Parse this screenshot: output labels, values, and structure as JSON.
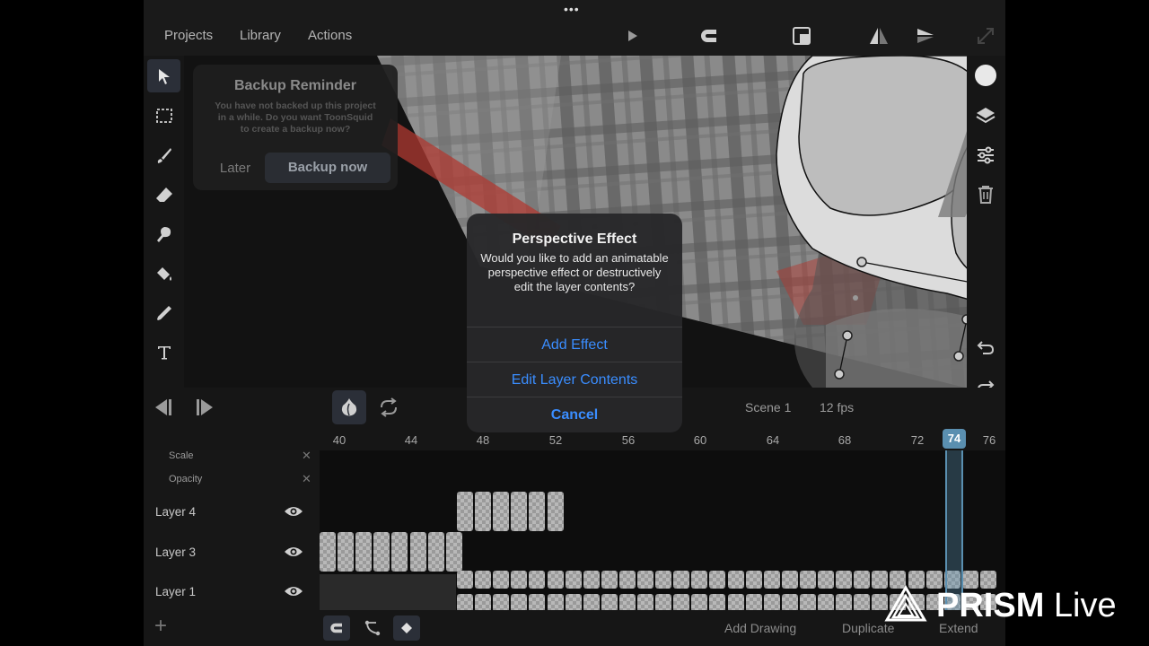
{
  "menu": {
    "projects": "Projects",
    "library": "Library",
    "actions": "Actions"
  },
  "top_dots": "•••",
  "backup_reminder": {
    "title": "Backup Reminder",
    "message": "You have not backed up this project in a while. Do you want ToonSquid to create a backup now?",
    "later": "Later",
    "backup_now": "Backup now"
  },
  "dialog": {
    "title": "Perspective Effect",
    "message": "Would you like to add an animatable perspective effect or destructively edit the layer contents?",
    "add_effect": "Add Effect",
    "edit_layer_contents": "Edit Layer Contents",
    "cancel": "Cancel"
  },
  "playback": {
    "scene": "Scene 1",
    "fps": "12 fps"
  },
  "ruler": {
    "ticks": [
      "40",
      "44",
      "48",
      "52",
      "56",
      "60",
      "64",
      "68",
      "72",
      "76"
    ],
    "current_frame": "74"
  },
  "properties": [
    "Scale",
    "Opacity"
  ],
  "layers": [
    "Layer 4",
    "Layer 3",
    "Layer 1"
  ],
  "bottom": {
    "add": "+",
    "add_drawing": "Add Drawing",
    "duplicate": "Duplicate",
    "extend": "Extend"
  },
  "watermark": {
    "brand": "PRISM",
    "suffix": "Live"
  },
  "colors": {
    "accent_blue": "#3a8dff",
    "red_stroke": "#c0392b",
    "playhead": "#5a8fb0"
  }
}
